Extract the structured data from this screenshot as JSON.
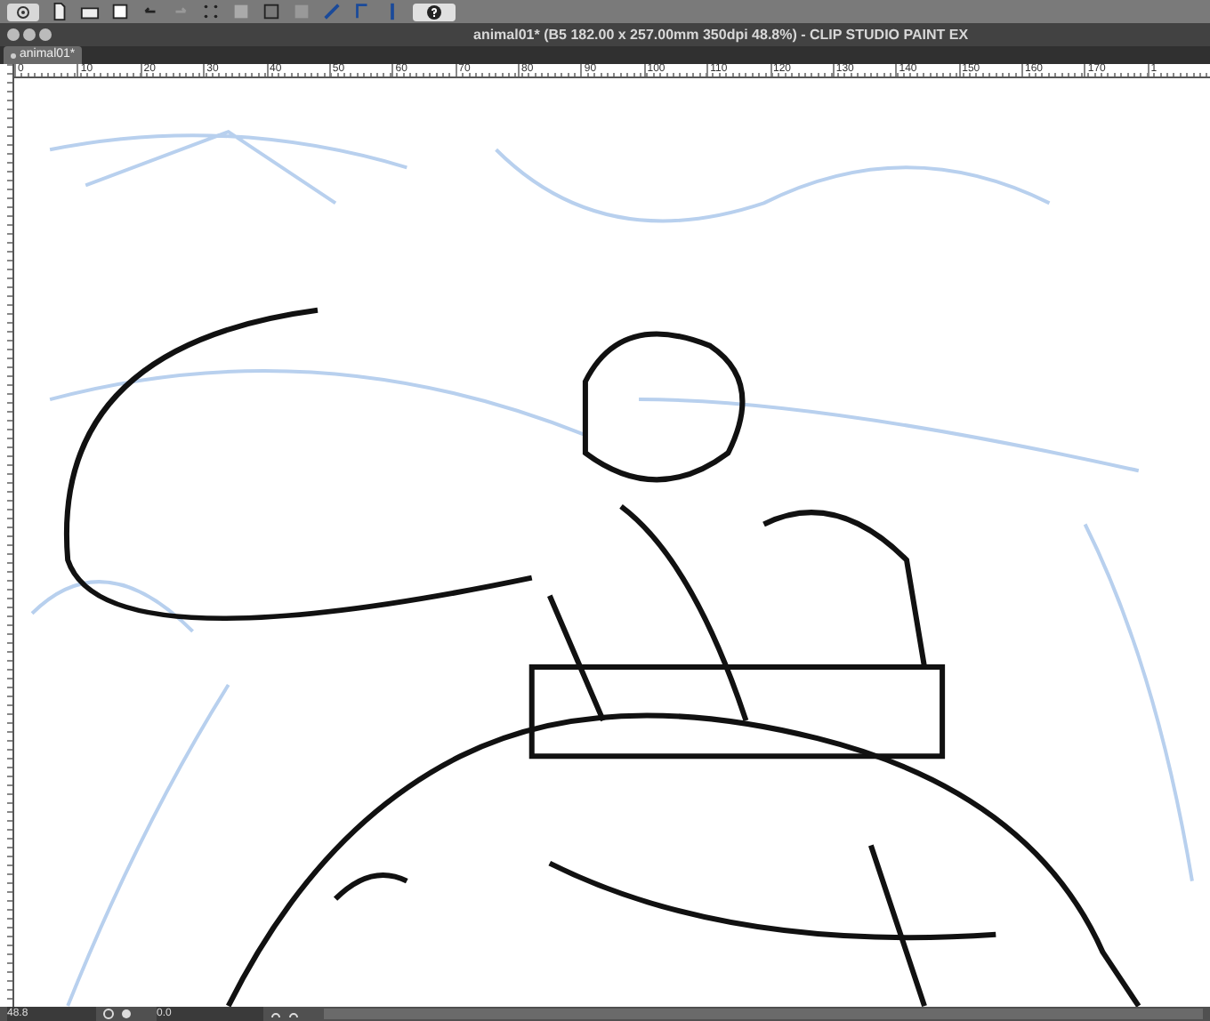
{
  "window": {
    "title": "animal01* (B5 182.00 x 257.00mm 350dpi 48.8%)  - CLIP STUDIO PAINT EX"
  },
  "tabs": [
    {
      "label": "animal01*",
      "selected": true
    }
  ],
  "ruler": {
    "labels": [
      "0",
      "10",
      "20",
      "30",
      "40",
      "50",
      "60",
      "70",
      "80",
      "90",
      "100",
      "110",
      "120",
      "130",
      "140",
      "150",
      "160",
      "170",
      "1"
    ]
  },
  "status_bar": {
    "zoom": "48.8",
    "rotation": "0.0"
  }
}
